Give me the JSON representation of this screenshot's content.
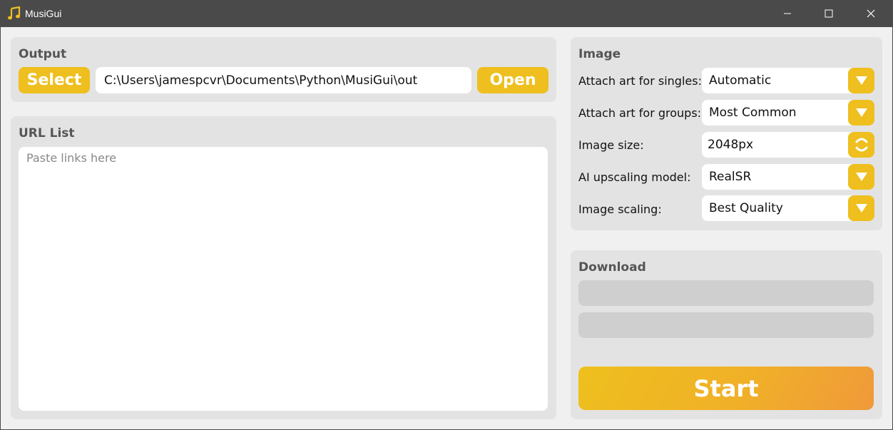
{
  "window": {
    "title": "MusiGui",
    "icon": "music-note-icon",
    "controls": [
      "minimize-icon",
      "maximize-icon",
      "close-icon"
    ]
  },
  "output": {
    "title": "Output",
    "select_label": "Select",
    "path_value": "C:\\Users\\jamespcvr\\Documents\\Python\\MusiGui\\out",
    "open_label": "Open"
  },
  "url_list": {
    "title": "URL List",
    "placeholder": "Paste links here",
    "value": ""
  },
  "image": {
    "title": "Image",
    "rows": [
      {
        "label": "Attach art for singles:",
        "value": "Automatic",
        "control": "dropdown"
      },
      {
        "label": "Attach art for groups:",
        "value": "Most Common",
        "control": "dropdown"
      },
      {
        "label": "Image size:",
        "value": "2048px",
        "control": "spinner"
      },
      {
        "label": "AI upscaling model:",
        "value": "RealSR",
        "control": "dropdown"
      },
      {
        "label": "Image scaling:",
        "value": "Best Quality",
        "control": "dropdown"
      }
    ]
  },
  "download": {
    "title": "Download",
    "progress": [
      0,
      0
    ],
    "start_label": "Start"
  },
  "colors": {
    "accent": "#eebf1e",
    "accent_gradient_end": "#f0993a",
    "titlebar": "#4a4a4a",
    "panel": "#e3e3e3",
    "background": "#f0f0f0"
  }
}
